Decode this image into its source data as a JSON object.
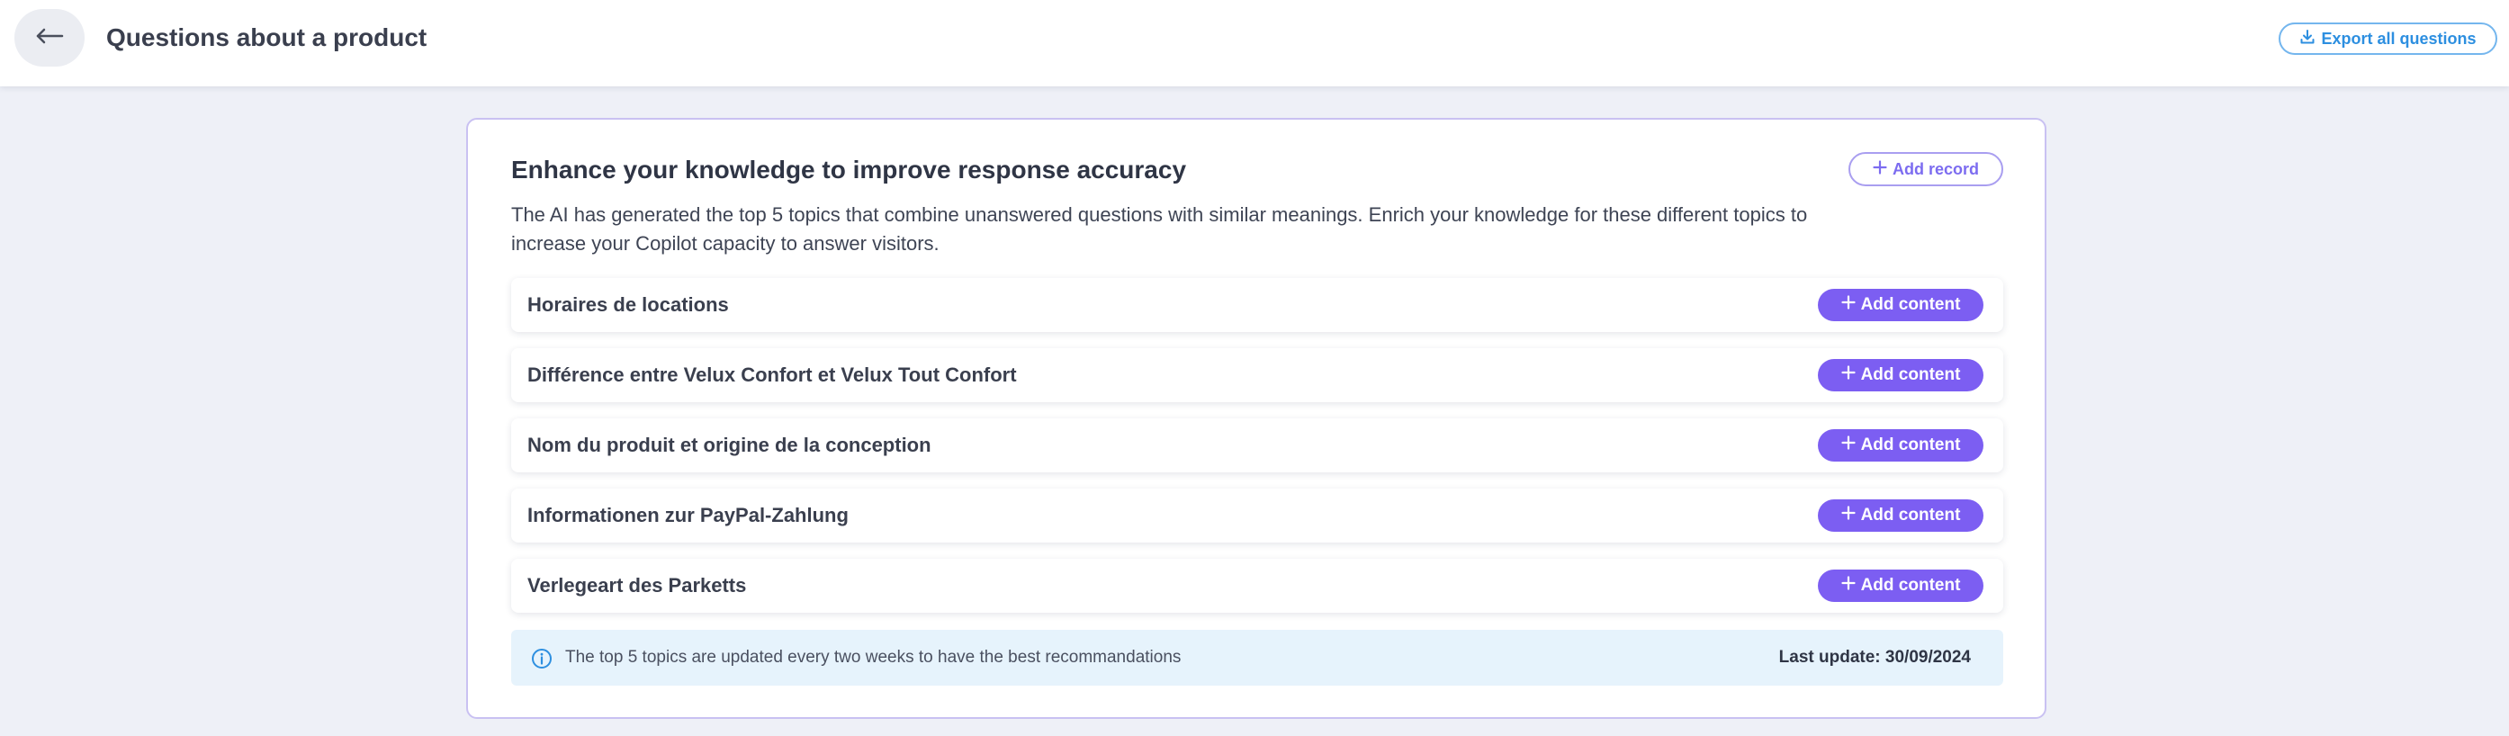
{
  "header": {
    "title": "Questions about a product",
    "back_icon": "arrow-left-icon",
    "export_label": "Export all questions",
    "export_icon": "download-icon"
  },
  "card": {
    "title": "Enhance your knowledge to improve response accuracy",
    "add_record_label": "Add record",
    "description": "The AI has generated the top 5 topics that combine unanswered questions with similar meanings. Enrich your knowledge for these different topics to increase your Copilot capacity to answer visitors.",
    "topics": [
      {
        "label": "Horaires de locations",
        "action_label": "Add content"
      },
      {
        "label": "Différence entre Velux Confort et Velux Tout Confort",
        "action_label": "Add content"
      },
      {
        "label": "Nom du produit et origine de la conception",
        "action_label": "Add content"
      },
      {
        "label": "Informationen zur PayPal-Zahlung",
        "action_label": "Add content"
      },
      {
        "label": "Verlegeart des Parketts",
        "action_label": "Add content"
      }
    ],
    "info": {
      "icon": "info-icon",
      "text": "The top 5 topics are updated every two weeks to have the best recommandations",
      "last_update": "Last update: 30/09/2024"
    }
  },
  "colors": {
    "accent_purple": "#7c5ef2",
    "accent_blue": "#2d8fe0",
    "card_border": "#c9c1f2",
    "info_background": "#e6f3fc",
    "page_background": "#eef0f7"
  }
}
